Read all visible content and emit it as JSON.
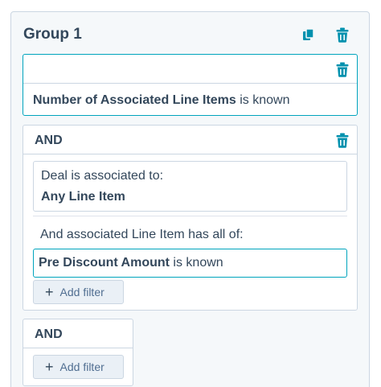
{
  "group": {
    "title": "Group 1",
    "icons": {
      "clone": "clone-icon",
      "delete": "trash-icon"
    }
  },
  "filter_card": {
    "property": "Number of Associated Line Items",
    "operator": " is known"
  },
  "and_block": {
    "label": "AND",
    "association_intro": "Deal is associated to:",
    "association_value": "Any Line Item",
    "sub_intro": "And associated Line Item has all of:",
    "sub_filter_property": "Pre Discount Amount",
    "sub_filter_operator": " is known",
    "add_filter_label": "Add filter"
  },
  "and_block_2": {
    "label": "AND",
    "add_filter_label": "Add filter"
  },
  "colors": {
    "accent": "#00a4bd",
    "text": "#33475b",
    "border": "#cbd6e2",
    "panel_bg": "#f5f8fa",
    "button_bg": "#eaf0f6"
  }
}
